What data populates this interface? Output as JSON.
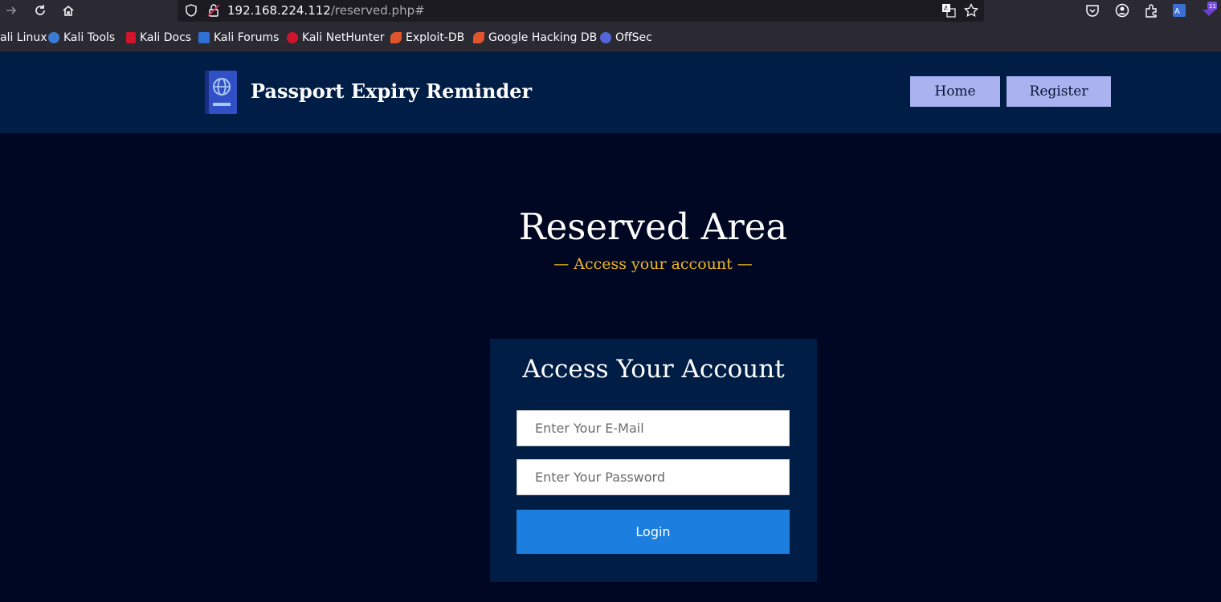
{
  "browser": {
    "url_host": "192.168.224.112",
    "url_path": "/reserved.php#",
    "extension_badge": "11",
    "bookmarks": [
      {
        "label": "ali Linux",
        "icon": "kali-icon",
        "color": "#3a7bd5"
      },
      {
        "label": "Kali Tools",
        "icon": "kali-tools-icon",
        "color": "#3a7bd5"
      },
      {
        "label": "Kali Docs",
        "icon": "kali-docs-icon",
        "color": "#d0142c"
      },
      {
        "label": "Kali Forums",
        "icon": "kali-forums-icon",
        "color": "#2f6fd6"
      },
      {
        "label": "Kali NetHunter",
        "icon": "nethunter-icon",
        "color": "#d0142c"
      },
      {
        "label": "Exploit-DB",
        "icon": "exploit-db-icon",
        "color": "#e0552b"
      },
      {
        "label": "Google Hacking DB",
        "icon": "ghdb-icon",
        "color": "#e0552b"
      },
      {
        "label": "OffSec",
        "icon": "offsec-icon",
        "color": "#5566dd"
      }
    ]
  },
  "site": {
    "title": "Passport Expiry Reminder",
    "nav": {
      "home": "Home",
      "register": "Register"
    }
  },
  "hero": {
    "title": "Reserved Area",
    "subtitle": "— Access your account —"
  },
  "login_card": {
    "title": "Access Your Account",
    "email_placeholder": "Enter Your E-Mail",
    "password_placeholder": "Enter Your Password",
    "login_label": "Login"
  },
  "colors": {
    "page_bg": "#000722",
    "header_bg": "#001d45",
    "nav_button_bg": "#aab3f0",
    "accent_gold": "#f1b620",
    "login_button": "#1c7fdf"
  }
}
